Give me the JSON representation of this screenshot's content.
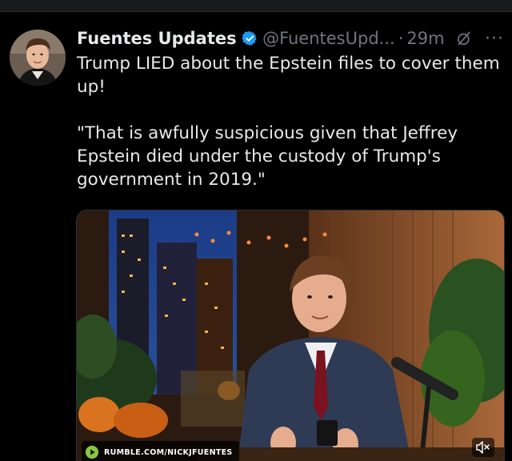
{
  "tweet": {
    "display_name": "Fuentes Updates",
    "handle": "@FuentesUpd...",
    "separator": "·",
    "time": "29m",
    "more_label": "···",
    "text": "Trump LIED about the Epstein files to cover them up!\n\n\"That is awfully suspicious given that Jeffrey Epstein died under the custody of Trump's government in 2019.\"",
    "verified": true,
    "icons": [
      "verified-badge-icon",
      "grok-icon",
      "more-icon"
    ]
  },
  "media": {
    "source_label": "RUMBLE.COM/NICKJFUENTES",
    "source_icon": "rumble-play-icon",
    "mute_icon": "speaker-muted-icon"
  },
  "colors": {
    "background": "#000000",
    "text_primary": "#e7e9ea",
    "text_secondary": "#71767b",
    "verified_blue": "#1d9bf0",
    "rumble_green": "#85c742"
  }
}
